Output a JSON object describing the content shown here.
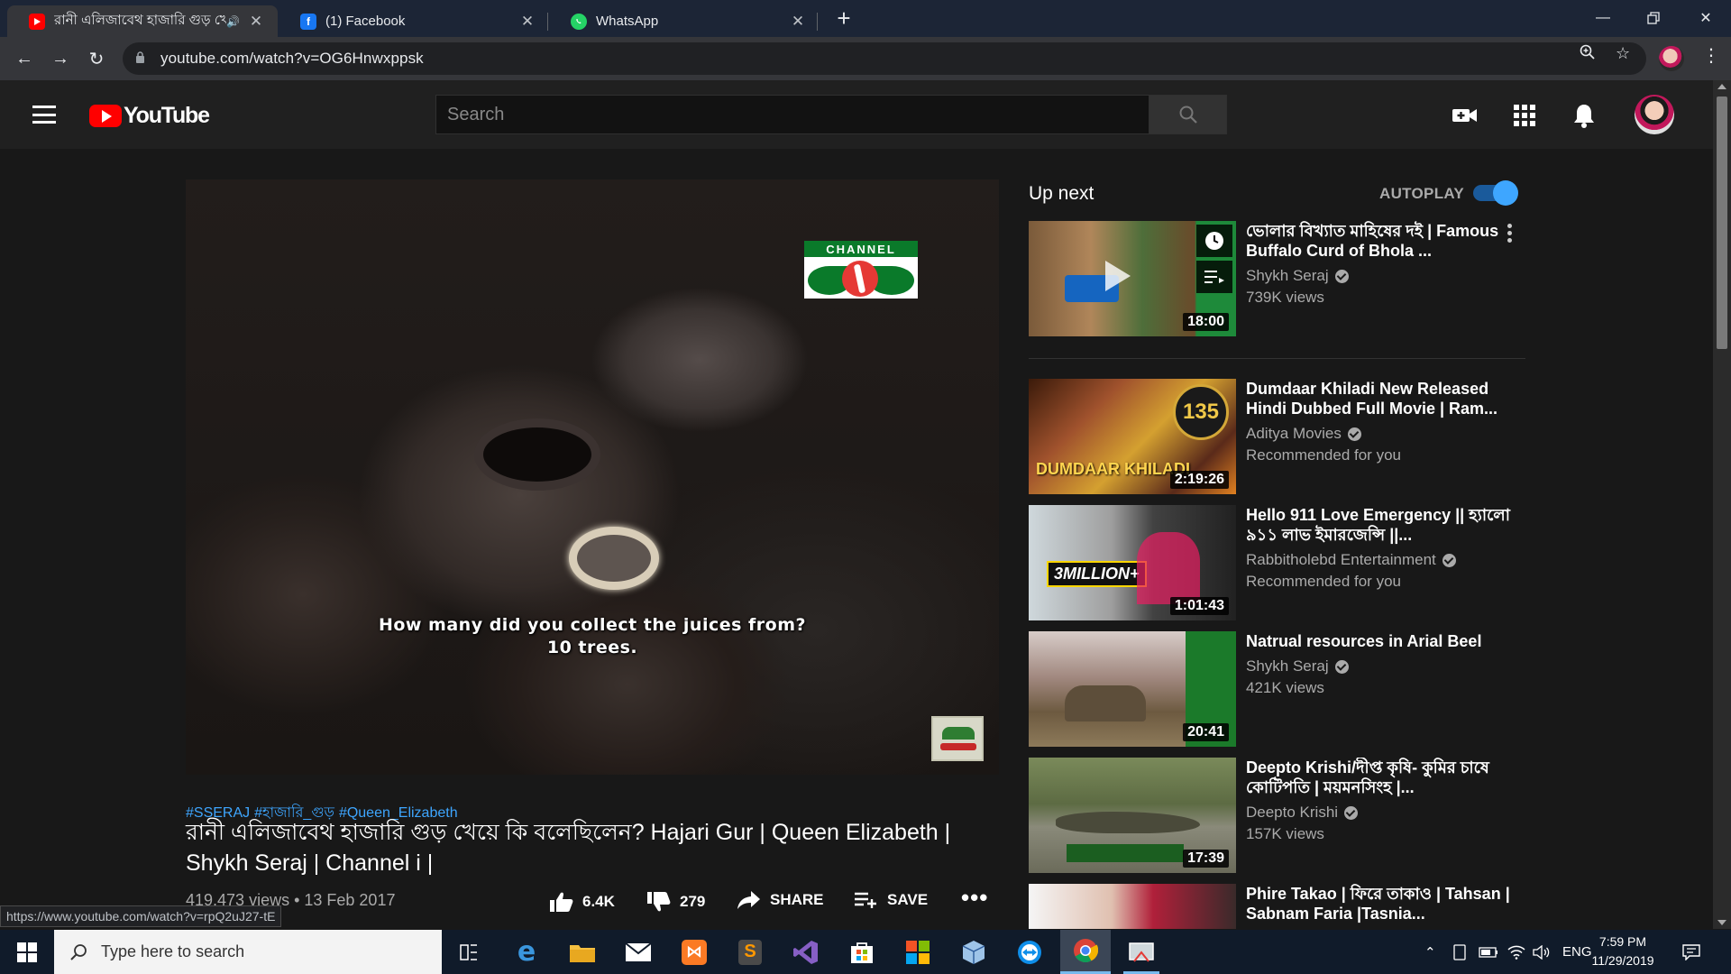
{
  "browser": {
    "tabs": [
      {
        "title": "রানী এলিজাবেথ হাজারি গুড় খে",
        "favicon": "youtube-favicon",
        "active": true
      },
      {
        "title": "(1) Facebook",
        "favicon": "facebook-favicon",
        "active": false
      },
      {
        "title": "WhatsApp",
        "favicon": "whatsapp-favicon",
        "active": false
      }
    ],
    "url": "youtube.com/watch?v=OG6Hnwxppsk"
  },
  "header": {
    "logo_text": "YouTube",
    "search_placeholder": "Search"
  },
  "video": {
    "subtitle_line1": "How many did you collect the juices from?",
    "subtitle_line2": "10 trees.",
    "channel_logo_text": "CHANNEL",
    "hashtags": [
      "#SSERAJ",
      "#হাজারি_গুড়",
      "#Queen_Elizabeth"
    ],
    "title": "রানী এলিজাবেথ হাজারি গুড় খেয়ে কি বলেছিলেন? Hajari Gur | Queen Elizabeth | Shykh Seraj | Channel i |",
    "views_date": "419,473 views • 13 Feb 2017",
    "likes": "6.4K",
    "dislikes": "279",
    "share_label": "SHARE",
    "save_label": "SAVE"
  },
  "sidebar": {
    "upnext_label": "Up next",
    "autoplay_label": "AUTOPLAY",
    "autoplay_on": true,
    "recommendations": [
      {
        "title": "ভোলার বিখ্যাত মাহিষের দই | Famous Buffalo Curd of Bhola ...",
        "channel": "Shykh Seraj",
        "meta": "739K views",
        "duration": "18:00",
        "verified": true
      },
      {
        "title": "Dumdaar Khiladi New Released Hindi Dubbed Full Movie | Ram...",
        "channel": "Aditya Movies",
        "meta": "Recommended for you",
        "duration": "2:19:26",
        "verified": true
      },
      {
        "title": "Hello 911 Love Emergency || হ্যালো ৯১১ লাভ ইমারজেন্সি ||...",
        "channel": "Rabbitholebd Entertainment",
        "meta": "Recommended for you",
        "duration": "1:01:43",
        "verified": true
      },
      {
        "title": "Natrual resources in Arial Beel",
        "channel": "Shykh Seraj",
        "meta": "421K views",
        "duration": "20:41",
        "verified": true
      },
      {
        "title": "Deepto Krishi/দীপ্ত কৃষি- কুমির চাষে কোটিপতি | ময়মনসিংহ |...",
        "channel": "Deepto Krishi",
        "meta": "157K views",
        "duration": "17:39",
        "verified": true
      },
      {
        "title": "Phire Takao | ফিরে তাকাও | Tahsan | Sabnam Faria |Tasnia...",
        "channel": "",
        "meta": "",
        "duration": "",
        "verified": false
      }
    ]
  },
  "status_link": "https://www.youtube.com/watch?v=rpQ2uJ27-tE",
  "taskbar": {
    "search_placeholder": "Type here to search",
    "language": "ENG",
    "time": "7:59 PM",
    "date": "11/29/2019"
  },
  "colors": {
    "youtube_red": "#ff0000",
    "link_blue": "#3ea6ff",
    "page_bg": "#181818",
    "header_bg": "#202020"
  }
}
